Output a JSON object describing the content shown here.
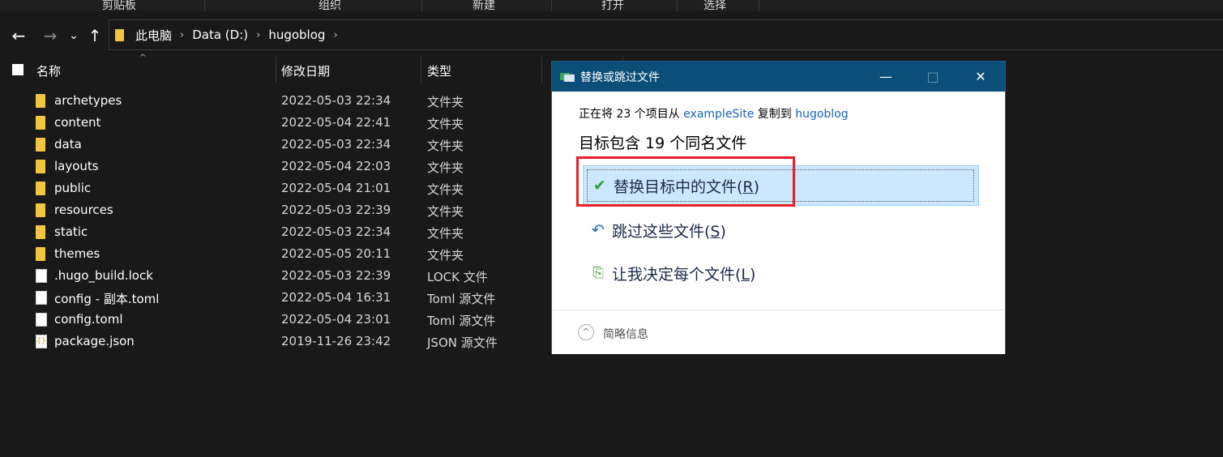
{
  "ribbon": {
    "groups": [
      "剪贴板",
      "组织",
      "新建",
      "打开",
      "选择"
    ]
  },
  "nav": {
    "back_icon": "←",
    "forward_icon": "→",
    "recent_icon": "⌄",
    "up_icon": "↑",
    "breadcrumb": [
      "此电脑",
      "Data (D:)",
      "hugoblog"
    ],
    "chevron": "›"
  },
  "columns": {
    "name": "名称",
    "date": "修改日期",
    "type": "类型",
    "sort_icon": "^"
  },
  "files": [
    {
      "name": "archetypes",
      "date": "2022-05-03 22:34",
      "type": "文件夹",
      "icon": "folder"
    },
    {
      "name": "content",
      "date": "2022-05-04 22:41",
      "type": "文件夹",
      "icon": "folder"
    },
    {
      "name": "data",
      "date": "2022-05-03 22:34",
      "type": "文件夹",
      "icon": "folder"
    },
    {
      "name": "layouts",
      "date": "2022-05-04 22:03",
      "type": "文件夹",
      "icon": "folder"
    },
    {
      "name": "public",
      "date": "2022-05-04 21:01",
      "type": "文件夹",
      "icon": "folder"
    },
    {
      "name": "resources",
      "date": "2022-05-03 22:39",
      "type": "文件夹",
      "icon": "folder"
    },
    {
      "name": "static",
      "date": "2022-05-03 22:34",
      "type": "文件夹",
      "icon": "folder"
    },
    {
      "name": "themes",
      "date": "2022-05-05 20:11",
      "type": "文件夹",
      "icon": "folder"
    },
    {
      "name": ".hugo_build.lock",
      "date": "2022-05-03 22:39",
      "type": "LOCK 文件",
      "icon": "file"
    },
    {
      "name": "config - 副本.toml",
      "date": "2022-05-04 16:31",
      "type": "Toml 源文件",
      "icon": "file"
    },
    {
      "name": "config.toml",
      "date": "2022-05-04 23:01",
      "type": "Toml 源文件",
      "icon": "file"
    },
    {
      "name": "package.json",
      "date": "2019-11-26 23:42",
      "type": "JSON 源文件",
      "icon": "json"
    }
  ],
  "dialog": {
    "title": "替换或跳过文件",
    "minimize_icon": "—",
    "maximize_icon": "□",
    "close_icon": "✕",
    "info_prefix": "正在将 23 个项目从 ",
    "source": "exampleSite",
    "info_mid": " 复制到 ",
    "dest": "hugoblog",
    "heading": "目标包含 19 个同名文件",
    "options": [
      {
        "text": "替换目标中的文件(",
        "key": "R",
        "suffix": ")",
        "icon": "✔",
        "color": "#2ea043"
      },
      {
        "text": "跳过这些文件(",
        "key": "S",
        "suffix": ")",
        "icon": "↶",
        "color": "#1f6fc5"
      },
      {
        "text": "让我决定每个文件(",
        "key": "L",
        "suffix": ")",
        "icon": "⎘",
        "color": "#4a9a3a"
      }
    ],
    "more_icon": "^",
    "more_label": "简略信息"
  },
  "colors": {
    "accent_title": "#0b4f78",
    "selected_option": "#cce8ff",
    "highlight_box": "#e8202a",
    "link": "#1763b5"
  }
}
